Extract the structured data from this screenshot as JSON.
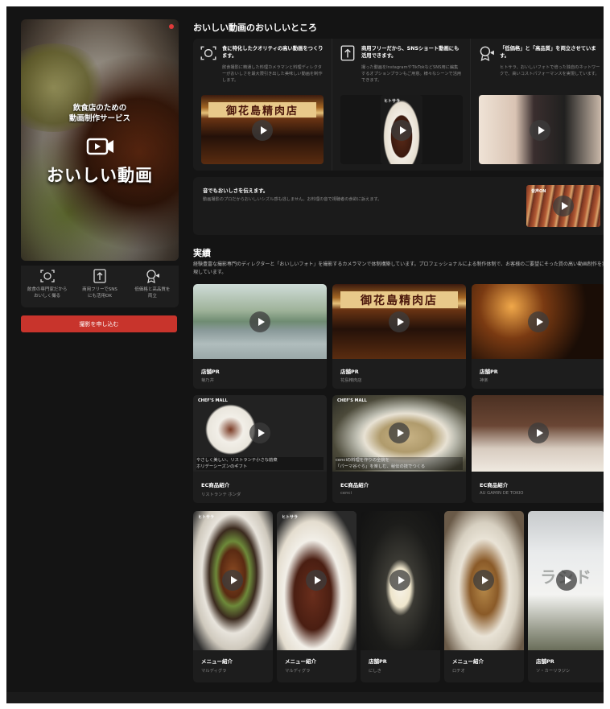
{
  "hero": {
    "subtitle_line1": "飲食店のための",
    "subtitle_line2": "動画制作サービス",
    "brand": "おいしい動画"
  },
  "left_features": [
    {
      "icon": "focus-camera-icon",
      "label": "飲食の専門家だから\nおいしく撮る"
    },
    {
      "icon": "upload-arrow-icon",
      "label": "商用フリーでSNS\nにも活用OK"
    },
    {
      "icon": "award-camera-icon",
      "label": "低価格と高品質を\n両立"
    }
  ],
  "cta_label": "撮影を申し込む",
  "section_features_title": "おいしい動画のおいしいところ",
  "features": [
    {
      "icon": "focus-camera-icon",
      "title": "食に特化したクオリティの高い動画をつくります。",
      "desc": "飲食撮影に精通した料理カメラマンと料理ディレクターがおいしさを最大限引き出した美味しい動画を制作します。"
    },
    {
      "icon": "upload-arrow-icon",
      "title": "商用フリーだから、SNSショート動画にも活用できます。",
      "desc": "撮った動画をInstagramやTikTokなどSNS用に編集するオプションプランもご用意。様々なシーンで活用できます。"
    },
    {
      "icon": "award-camera-icon",
      "title": "「低価格」と「高品質」を両立させています。",
      "desc": "ヒトサラ、おいしいフォトで培った独自のネットワークで、高いコストパフォーマンスを実現しています。"
    }
  ],
  "sound_card": {
    "title": "音でもおいしさを伝えます。",
    "desc": "動画撮影のプロだからおいしいシズル感も逃しません。お料理の音で視聴者の食欲に訴えます。",
    "thumb_label": "音声ON"
  },
  "section_achievements_title": "実績",
  "achievements_desc": "経験豊富な撮影専門のディレクターと「おいしいフォト」を撮影するカメラマンで体制構築しています。プロフェッショナルによる制作体制で、お客様のご要望にそった質の高い動画制作を実現しています。",
  "row1": [
    {
      "category": "店舗PR",
      "name": "菊乃井"
    },
    {
      "category": "店舗PR",
      "name": "花島精肉店"
    },
    {
      "category": "店舗PR",
      "name": "神楽"
    }
  ],
  "row2": [
    {
      "category": "EC商品紹介",
      "name": "リストランテ ホンダ",
      "caption": "やさしく美しい、リストランテ小さな前菜\nホリデーシーズンのギフト"
    },
    {
      "category": "EC商品紹介",
      "name": "cenci",
      "caption": "cenciの料理を作りの全貌を\n「パーマ谷ぐら」を楽しむ、秘伝の技でつくる"
    },
    {
      "category": "EC商品紹介",
      "name": "AU GAMIN DE TOKIO",
      "caption": ""
    }
  ],
  "row3": [
    {
      "category": "メニュー紹介",
      "name": "マルディグラ"
    },
    {
      "category": "メニュー紹介",
      "name": "マルディグラ"
    },
    {
      "category": "店舗PR",
      "name": "にしき"
    },
    {
      "category": "メニュー紹介",
      "name": "ロチオ"
    },
    {
      "category": "店舗PR",
      "name": "ソ・カーリラジシ"
    }
  ],
  "shop_sign_text": "御花島精肉店",
  "chefs_mall_label": "CHEF'S MALL",
  "hitosara_label": "ヒトサラ",
  "storefront_text": "ラシド",
  "colors": {
    "accent_red": "#c8342c",
    "background": "#141414",
    "card": "#1d1d1d"
  }
}
